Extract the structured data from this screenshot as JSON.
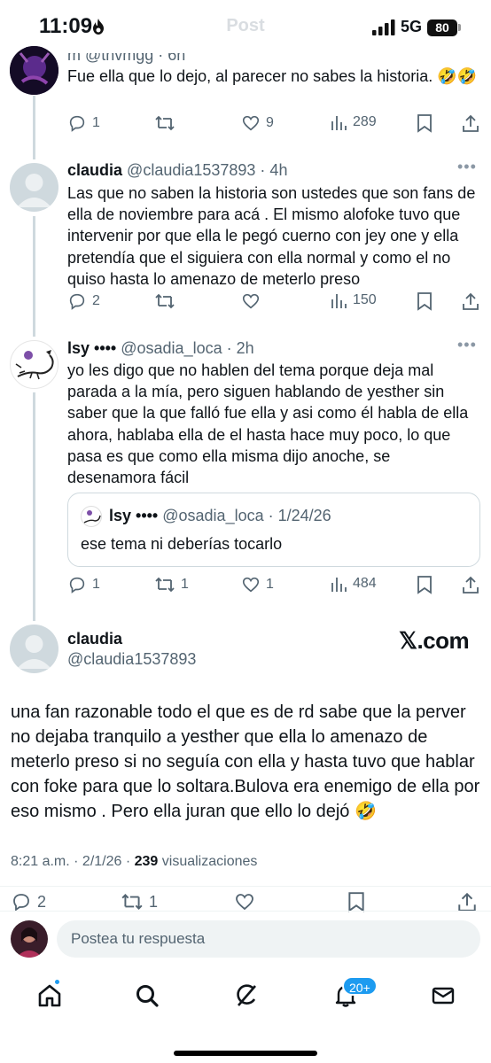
{
  "status_bar": {
    "time": "11:09",
    "title": "Post",
    "network": "5G",
    "battery": "80"
  },
  "partial_tweet": {
    "handle_fragment": "m @thvmgg · 6h",
    "text": "Fue ella que lo dejo, al parecer no sabes la historia. 🤣🤣",
    "replies": "1",
    "reposts": "",
    "likes": "9",
    "views": "289"
  },
  "tweet_claudia": {
    "name": "claudia",
    "handle": "@claudia1537893 · 4h",
    "text": "Las que no saben la historia son ustedes que son fans de ella de noviembre para acá . El mismo alofoke tuvo que intervenir por que ella le pegó cuerno con jey one y ella pretendía que el siguiera con ella normal y como el no quiso hasta lo amenazo de meterlo preso",
    "replies": "2",
    "reposts": "",
    "likes": "",
    "views": "150"
  },
  "tweet_lsy": {
    "name": "lsy ••••",
    "handle": "@osadia_loca · 2h",
    "text": "yo les digo que no hablen del tema porque deja mal parada a la mía, pero siguen hablando de yesther sin saber que la que falló fue ella y asi como él habla de ella ahora, hablaba ella de el hasta hace muy poco, lo que pasa es que como ella misma dijo anoche, se desenamora fácil",
    "quote": {
      "name": "lsy ••••",
      "handle": "@osadia_loca · 1/24/26",
      "text": "ese tema ni deberías tocarlo"
    },
    "replies": "1",
    "reposts": "1",
    "likes": "1",
    "views": "484"
  },
  "main_tweet": {
    "name": "claudia",
    "handle": "@claudia1537893",
    "watermark": "𝕏.com",
    "text": "una fan razonable todo el que es de rd sabe que la perver no dejaba tranquilo a yesther que ella lo amenazo de meterlo preso si no seguía con ella y hasta tuvo que hablar con foke para que lo soltara.Bulova era enemigo de ella por eso mismo . Pero ella juran que ello lo dejó 🤣",
    "time_date": "8:21 a.m. · 2/1/26 · ",
    "views_count": "239",
    "views_label": " visualizaciones",
    "replies": "2",
    "reposts": "1"
  },
  "reply_bar": {
    "placeholder": "Postea tu respuesta"
  },
  "tab_bar": {
    "items": [
      "home-icon",
      "search-icon",
      "grok-icon",
      "bell-icon",
      "mail-icon"
    ],
    "notification_badge": "20+"
  },
  "colors": {
    "accent": "#1d9bf0",
    "text": "#0f1419",
    "secondary": "#536471",
    "border": "#cfd9de"
  }
}
